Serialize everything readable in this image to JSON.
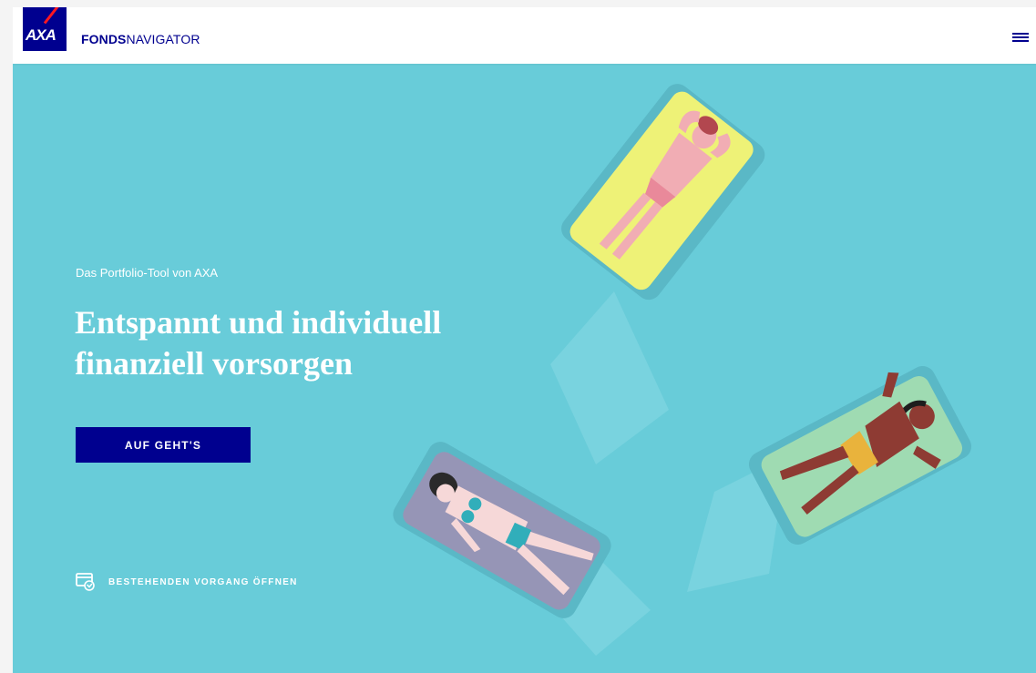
{
  "header": {
    "logo_text": "AXA",
    "brand_bold": "FONDS",
    "brand_regular": "NAVIGATOR",
    "menu_icon": "hamburger-menu-icon"
  },
  "hero": {
    "eyebrow": "Das Portfolio-Tool von AXA",
    "headline_line1": "Entspannt und individuell",
    "headline_line2": "finanziell vorsorgen",
    "cta_label": "AUF GEHT'S",
    "open_existing_label": "BESTEHENDEN VORGANG ÖFFNEN",
    "open_existing_icon": "restore-window-icon",
    "illustration_icon": "pool-float-illustration"
  },
  "colors": {
    "brand_blue": "#00008f",
    "brand_red": "#ff1721",
    "pool": "#68ccd9",
    "text_on_pool": "#ffffff"
  }
}
